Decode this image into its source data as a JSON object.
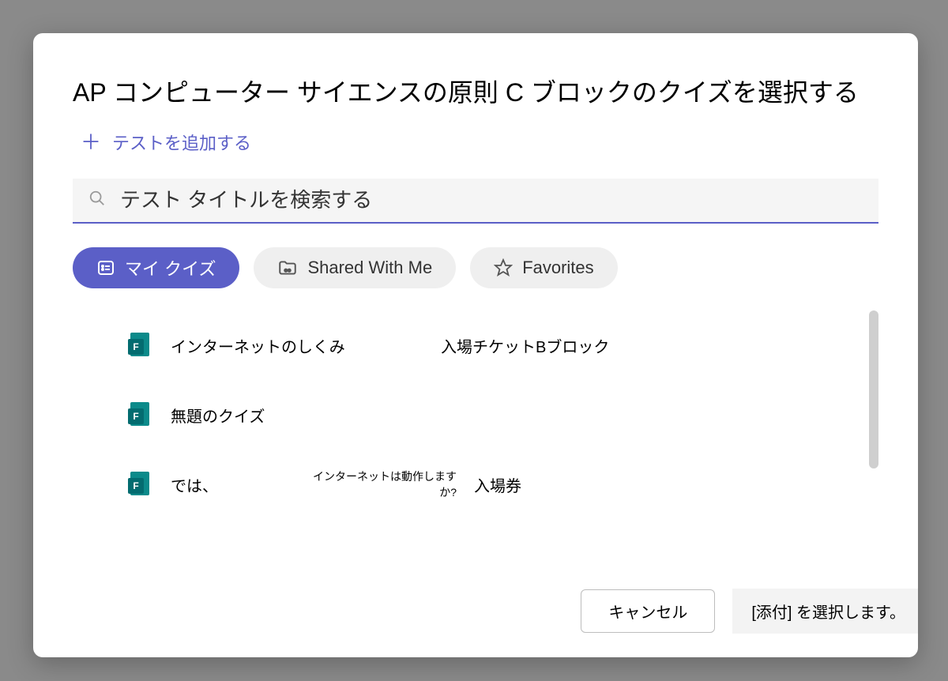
{
  "dialog": {
    "title": "AP コンピューター サイエンスの原則 C ブロックのクイズを選択する",
    "add_test_label": "テストを追加する",
    "search": {
      "placeholder": "テスト タイトルを検索する"
    },
    "tabs": {
      "my_quizzes": "マイ クイズ",
      "shared_with_me": "Shared With Me",
      "favorites": "Favorites"
    },
    "quiz_list": [
      {
        "col1": "インターネットのしくみ",
        "col2": "入場チケットBブロック",
        "col2_small": ""
      },
      {
        "col1": "無題のクイズ",
        "col2": "",
        "col2_small": ""
      },
      {
        "col1": "では、",
        "col2": "入場券",
        "col2_small": "インターネットは動作しますか?"
      }
    ],
    "footer": {
      "cancel": "キャンセル",
      "attach": "[添付] を選択します。"
    }
  }
}
